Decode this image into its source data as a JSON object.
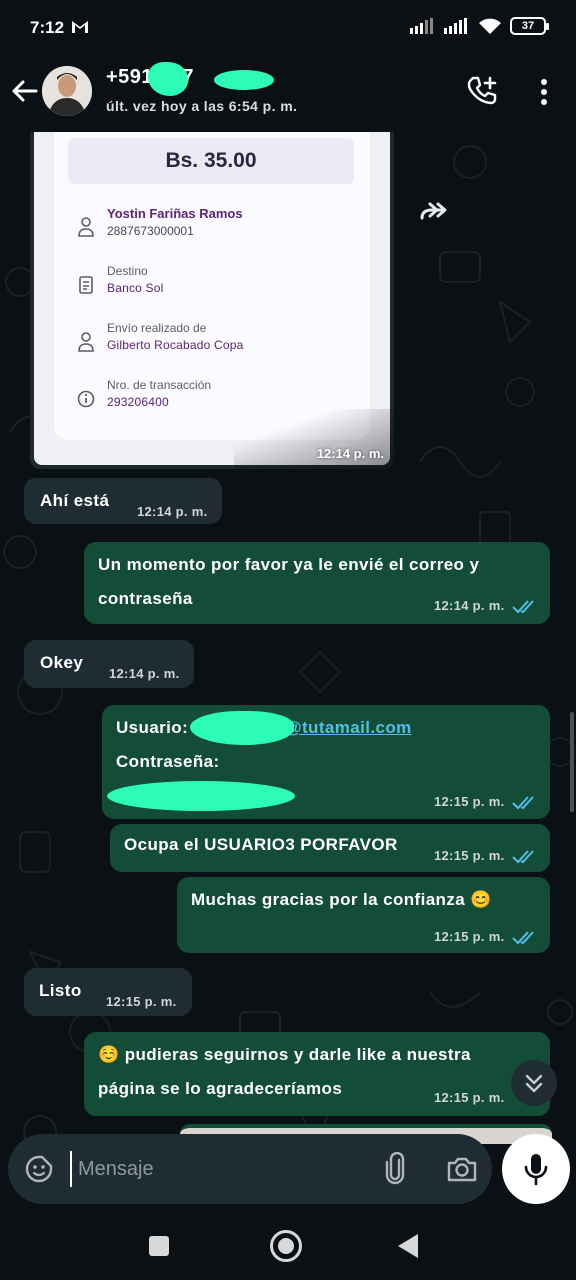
{
  "status_bar": {
    "time": "7:12",
    "battery": "37"
  },
  "header": {
    "contact_name": "+591 767",
    "last_seen": "últ. vez hoy a las 6:54 p. m."
  },
  "receipt": {
    "amount": "Bs. 35.00",
    "recipient_name": "Yostin Fariñas Ramos",
    "recipient_account": "2887673000001",
    "destination_label": "Destino",
    "destination_value": "Banco Sol",
    "sender_label": "Envío realizado de",
    "sender_value": "Gilberto Rocabado Copa",
    "transaction_label": "Nro. de transacción",
    "transaction_value": "293206400",
    "time": "12:14 p. m."
  },
  "messages": [
    {
      "direction": "in",
      "text": "Ahí está",
      "time": "12:14 p. m."
    },
    {
      "direction": "out",
      "line1": "Un momento por favor ya le envié el correo y",
      "line2": "contraseña",
      "time": "12:14 p. m."
    },
    {
      "direction": "in",
      "text": "Okey",
      "time": "12:14 p. m."
    },
    {
      "direction": "out",
      "user_label": "Usuario:",
      "email_domain": "@tutamail.com",
      "password_label": "Contraseña:",
      "time": "12:15 p. m."
    },
    {
      "direction": "out",
      "text": "Ocupa el USUARIO3 PORFAVOR",
      "time": "12:15 p. m."
    },
    {
      "direction": "out",
      "text": "Muchas gracias por la confianza 😊",
      "time": "12:15 p. m."
    },
    {
      "direction": "in",
      "text": "Listo",
      "time": "12:15 p. m."
    },
    {
      "direction": "out",
      "line1": "☺️ pudieras seguirnos y darle like a nuestra",
      "line2": "página se lo agradeceríamos",
      "time": "12:15 p. m."
    }
  ],
  "composer": {
    "placeholder": "Mensaje"
  },
  "colors": {
    "incoming": "#1f2c33",
    "outgoing": "#134d37",
    "read_ticks": "#53bdeb",
    "background": "#0b1014"
  },
  "icons": [
    "back-arrow-icon",
    "add-call-icon",
    "more-vert-icon",
    "forward-icon",
    "sticker-icon",
    "attach-icon",
    "camera-icon",
    "mic-icon",
    "chevron-down-double-icon"
  ]
}
